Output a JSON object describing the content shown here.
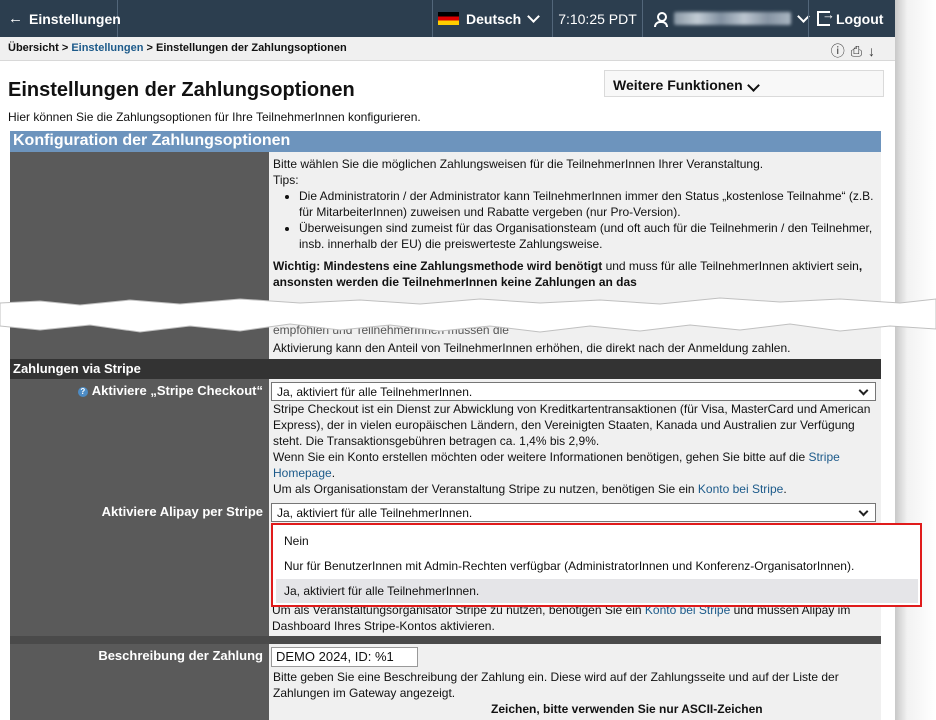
{
  "topbar": {
    "back_label": "Einstellungen",
    "language": "Deutsch",
    "time": "7:10:25 PDT",
    "logout_label": "Logout"
  },
  "breadcrumb": {
    "item1": "Übersicht",
    "sep": ">",
    "item2": "Einstellungen",
    "item3": "Einstellungen der Zahlungsoptionen"
  },
  "page": {
    "title": "Einstellungen der Zahlungsoptionen",
    "more_functions": "Weitere Funktionen",
    "intro": "Hier können Sie die Zahlungsoptionen für Ihre TeilnehmerInnen konfigurieren."
  },
  "config": {
    "heading": "Konfiguration der Zahlungsoptionen",
    "line1": "Bitte wählen Sie die möglichen Zahlungsweisen für die TeilnehmerInnen Ihrer Veranstaltung.",
    "tips": "Tips:",
    "tip1": "Die Administratorin / der Administrator kann TeilnehmerInnen immer den Status „kostenlose Teilnahme“ (z.B. für MitarbeiterInnen) zuweisen und Rabatte vergeben (nur Pro-Version).",
    "tip2": "Überweisungen sind zumeist für das Organisationsteam (und oft auch für die Teilnehmerin / den Teilnehmer, insb. innerhalb der EU) die preiswerteste Zahlungsweise.",
    "important_bold": "Wichtig: Mindestens eine Zahlungsmethode wird benötigt",
    "important_mid": " und muss für alle TeilnehmerInnen aktiviert sein",
    "important_bold2": ", ansonsten werden die TeilnehmerInnen keine Zahlungen an das",
    "partial_line": "empfohlen und TeilnehmerInnen müssen die",
    "last_line": "Aktivierung kann den Anteil von TeilnehmerInnen erhöhen, die direkt nach der Anmeldung zahlen."
  },
  "stripe": {
    "heading": "Zahlungen via Stripe",
    "checkout_label": "Aktiviere „Stripe Checkout“",
    "checkout_value": "Ja, aktiviert für alle TeilnehmerInnen.",
    "desc1": "Stripe Checkout ist ein Dienst zur Abwicklung von Kreditkartentransaktionen (für Visa, MasterCard und American Express), der in vielen europäischen Ländern, den Vereinigten Staaten, Kanada und Australien zur Verfügung steht. Die Transaktionsgebühren betragen ca. 1,4% bis 2,9%.",
    "desc2": "Wenn Sie ein Konto erstellen möchten oder weitere Informationen benötigen, gehen Sie bitte auf die ",
    "homepage_link": "Stripe Homepage",
    "desc3": "Um als Organisationstam der Veranstaltung Stripe zu nutzen, benötigen Sie ein ",
    "account_link": "Konto bei Stripe",
    "alipay_label": "Aktiviere Alipay per Stripe",
    "alipay_value": "Ja, aktiviert für alle TeilnehmerInnen.",
    "alipay_options": [
      "Nein",
      "Nur für BenutzerInnen mit Admin-Rechten verfügbar (AdministratorInnen und Konferenz-OrganisatorInnen).",
      "Ja, aktiviert für alle TeilnehmerInnen."
    ],
    "alipay_desc1": "Um als Veranstaltungsorganisator Stripe zu nutzen, benötigen Sie ein ",
    "alipay_link": "Konto bei Stripe",
    "alipay_desc2": " und müssen Alipay im Dashboard Ihres Stripe-Kontos aktivieren."
  },
  "payment_desc": {
    "label": "Beschreibung der Zahlung",
    "value": "DEMO 2024, ID: %1",
    "help": "Bitte geben Sie eine Beschreibung der Zahlung ein. Diese wird auf der Zahlungsseite und auf der Liste der Zahlungen im Gateway angezeigt.",
    "partial": "Zeichen, bitte verwenden Sie nur ASCII-Zeichen"
  },
  "colors": {
    "topbar": "#2c3e4f",
    "section_blue": "#6d94bd",
    "label_gray": "#5a5a5a",
    "highlight_red": "#e01b1b",
    "link": "#1c5a8a"
  }
}
